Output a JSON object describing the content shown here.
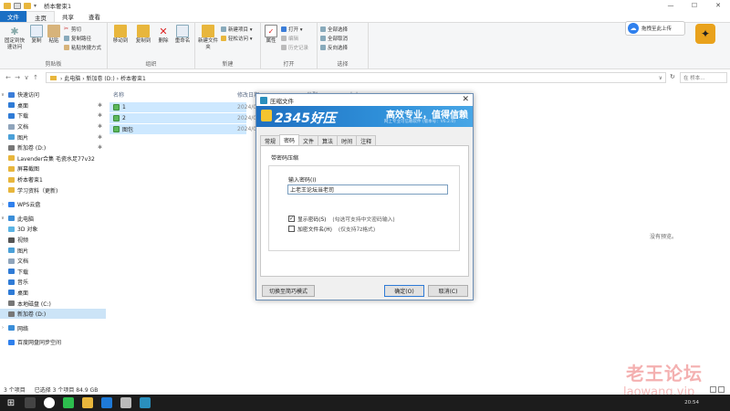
{
  "window": {
    "title": "桥本奢束1",
    "controls": {
      "min": "—",
      "max": "☐",
      "close": "✕"
    }
  },
  "ribbon_tabs": [
    "文件",
    "主页",
    "共享",
    "查看"
  ],
  "ribbon": {
    "clipboard": {
      "title": "剪贴板",
      "pin_quick": "固定到快速访问",
      "copy": "复制",
      "paste": "粘贴",
      "cut": "剪切",
      "copy_path": "复制路径",
      "paste_shortcut": "粘贴快捷方式"
    },
    "organize": {
      "title": "组织",
      "move_to": "移动到",
      "copy_to": "复制到",
      "delete": "删除",
      "rename": "重命名"
    },
    "new": {
      "title": "新建",
      "new_folder": "新建文件夹",
      "new_item": "新建项目 ▾",
      "easy_access": "轻松访问 ▾"
    },
    "open": {
      "title": "打开",
      "properties": "属性",
      "open": "打开 ▾",
      "edit": "编辑",
      "history": "历史记录"
    },
    "select": {
      "title": "选择",
      "select_all": "全部选择",
      "select_none": "全部取消",
      "invert": "反向选择"
    }
  },
  "upload_button": "拖拽至此上传",
  "address": {
    "nav_back": "←",
    "nav_forward": "→",
    "nav_recent": "∨",
    "nav_up": "↑",
    "path": "›  此电脑  ›  新加卷 (D:)  ›  桥本奢束1",
    "dropdown": "∨",
    "refresh": "↻",
    "search_placeholder": "在 桥本..."
  },
  "navpane": {
    "quick_access": "快速访问",
    "items": [
      {
        "label": "桌面",
        "pin": "✱"
      },
      {
        "label": "下载",
        "pin": "✱"
      },
      {
        "label": "文档",
        "pin": "✱"
      },
      {
        "label": "图片",
        "pin": "✱"
      },
      {
        "label": "新加卷 (D:)",
        "pin": "✱"
      },
      {
        "label": "Lavender合集 毛瓷水足77v32",
        "pin": ""
      },
      {
        "label": "屏幕截图",
        "pin": ""
      },
      {
        "label": "桥本奢束1",
        "pin": ""
      },
      {
        "label": "学习资料（更新)",
        "pin": ""
      }
    ],
    "wps": "WPS云盘",
    "this_pc": "此电脑",
    "pc_items": [
      "3D 对象",
      "视频",
      "图片",
      "文档",
      "下载",
      "音乐",
      "桌面",
      "本地磁盘 (C:)",
      "新加卷 (D:)"
    ],
    "network": "网络",
    "baidu": "百度网盘同步空间"
  },
  "columns": {
    "name": "名称",
    "date": "修改日期",
    "type": "类型",
    "size": "大小"
  },
  "files": [
    {
      "name": "1",
      "date": "2024/0"
    },
    {
      "name": "2",
      "date": "2024/0"
    },
    {
      "name": "图包",
      "date": "2024/0"
    }
  ],
  "preview_empty": "没有预览。",
  "status": {
    "count": "3 个项目",
    "selected": "已选择 3 个项目  84.9 GB"
  },
  "taskbar": {
    "start": "⊞",
    "time": "20:54"
  },
  "watermark": {
    "line1": "老王论坛",
    "line2": "laowang.vip"
  },
  "dialog": {
    "title": "压缩文件",
    "close": "✕",
    "brand": "2345好压",
    "slogan": "高效专业，值得信赖",
    "subslogan": "网上专业可信赖软件 (版本号：V6.2.0)",
    "tabs": [
      "常规",
      "密码",
      "文件",
      "算法",
      "时间",
      "注释"
    ],
    "active_tab": 1,
    "group_label": "带密码压缩",
    "password_label": "输入密码(I)",
    "password_value": "上老王论坛当老司",
    "show_password": {
      "label": "显示密码(S)",
      "hint": "(勾选可支持中文密码输入)",
      "checked": true
    },
    "encrypt_names": {
      "label": "加密文件名(H)",
      "hint": "(仅支持7z格式)",
      "checked": false
    },
    "switch_mode": "切换至简巧模式",
    "ok": "确定(O)",
    "cancel": "取消(C)"
  },
  "colors": {
    "accent": "#1a6fc4",
    "selection": "#cde8ff",
    "banner": "#1f6fc0",
    "watermark": "#e65050"
  }
}
